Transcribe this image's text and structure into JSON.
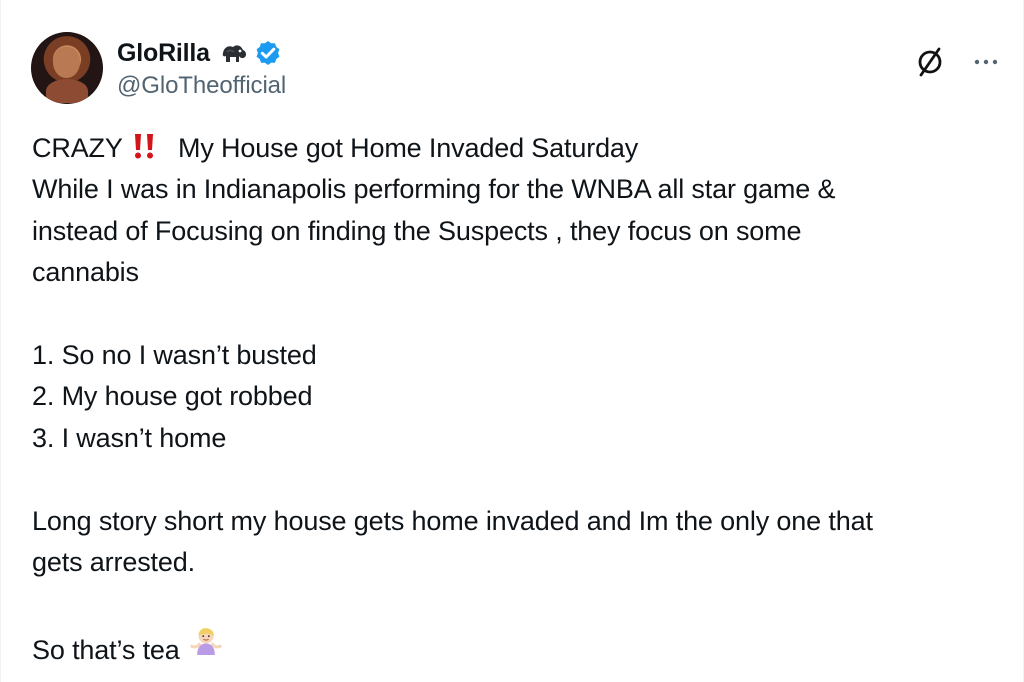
{
  "author": {
    "display_name": "GloRilla",
    "handle": "@GloTheofficial",
    "avatar_icon": "profile-photo",
    "name_emoji_icon": "gorilla-icon",
    "verified_icon": "verified-badge-icon"
  },
  "header_actions": {
    "grok_icon": "grok-icon",
    "more_icon": "more-options-icon"
  },
  "tweet": {
    "line1_start": "CRAZY",
    "line1_emoji": "double-exclamation-icon",
    "line1_end": "My House got Home Invaded Saturday",
    "line2": "While I was in Indianapolis performing for the WNBA all star game &",
    "line3": "instead of Focusing on finding the Suspects , they focus on some",
    "line4": "cannabis",
    "list": [
      "1. So no I wasn’t  busted",
      "2. My house got robbed",
      "3. I wasn’t home"
    ],
    "closing_line1": "Long story short my house gets home invaded and Im the only one that",
    "closing_line2": "gets arrested.",
    "final_text": "So that’s tea",
    "final_emoji": "person-shrugging-icon"
  },
  "colors": {
    "text": "#0f1419",
    "secondary_text": "#536471",
    "verified_blue": "#1d9bf0",
    "alert_red": "#d4141b",
    "border": "#eff3f4"
  }
}
